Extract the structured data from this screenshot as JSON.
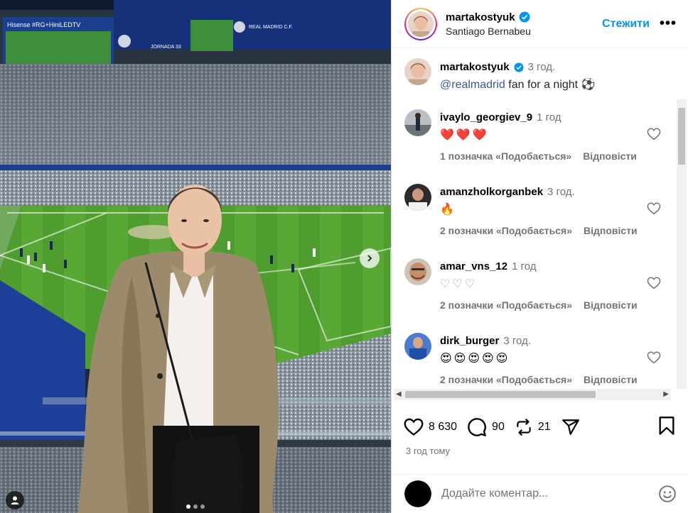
{
  "post": {
    "username": "martakostyuk",
    "location": "Santiago Bernabeu",
    "follow_label": "Стежити",
    "more_label": "•••",
    "caption": {
      "username": "martakostyuk",
      "time": "3 год.",
      "mention": "@realmadrid",
      "text": " fan for a night ⚽"
    },
    "stadium": {
      "board_left_text": "Hisense  #RG+HiniLEDTV",
      "board_right_text": "REAL MADRID C.F.",
      "board_mid_text": "JORNADA 33"
    },
    "carousel": {
      "count": 3,
      "active": 0
    }
  },
  "comments": [
    {
      "username": "ivaylo_georgiev_9",
      "time": "1 год",
      "text": "❤️❤️❤️",
      "likes": "1 позначка «Подобається»",
      "reply": "Відповісти"
    },
    {
      "username": "amanzholkorganbek",
      "time": "3 год.",
      "text": "🔥",
      "likes": "2 позначки «Подобається»",
      "reply": "Відповісти"
    },
    {
      "username": "amar_vns_12",
      "time": "1 год",
      "text": "♡♡♡",
      "likes": "2 позначки «Подобається»",
      "reply": "Відповісти"
    },
    {
      "username": "dirk_burger",
      "time": "3 год.",
      "text": "😍😍😍😍😍",
      "likes": "2 позначки «Подобається»",
      "reply": "Відповісти"
    }
  ],
  "stats": {
    "likes": "8 630",
    "comments": "90",
    "reposts": "21"
  },
  "posted_ago": "3 год тому",
  "add_comment_placeholder": "Додайте коментар...",
  "colors": {
    "accent": "#0095f6",
    "verified": "#0095f6",
    "muted": "#737373"
  }
}
